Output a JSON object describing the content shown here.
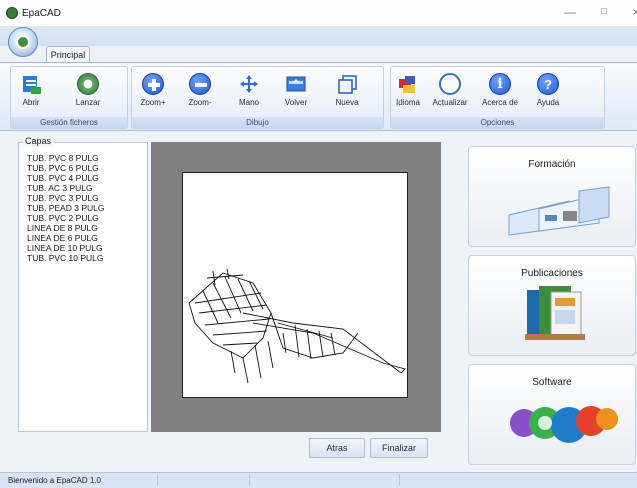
{
  "window": {
    "title": "EpaCAD",
    "minimize": "—",
    "maximize": "□",
    "close": "×"
  },
  "ribbon": {
    "tab": "Principal",
    "groups": [
      {
        "label": "Gestión ficheros",
        "buttons": [
          "Abrir",
          "Lanzar"
        ]
      },
      {
        "label": "Dibujo",
        "buttons": [
          "Zoom+",
          "Zoom-",
          "Mano",
          "Volver",
          "Nueva"
        ]
      },
      {
        "label": "Opciones",
        "buttons": [
          "Idioma",
          "Actualizar",
          "Acerca de",
          "Ayuda"
        ]
      }
    ]
  },
  "layers": {
    "legend": "Capas",
    "items": [
      "TUB. PVC 8 PULG",
      "TUB. PVC 6 PULG",
      "TUB. PVC 4 PULG",
      "TUB. AC 3 PULG",
      "TUB. PVC 3 PULG",
      "TUB. PEAD 3 PULG",
      "TUB. PVC 2 PULG",
      "LINEA DE 8 PULG",
      "LINEA DE 6 PULG",
      "LINEA DE 10 PULG",
      "TUB. PVC 10 PULG"
    ]
  },
  "actions": {
    "back": "Atras",
    "finish": "Finalizar"
  },
  "cards": [
    {
      "title": "Formación"
    },
    {
      "title": "Publicaciones"
    },
    {
      "title": "Software"
    }
  ],
  "status": {
    "text": "Bienvenido a EpaCAD 1.0"
  },
  "icons": {
    "app": "epacad-logo-icon",
    "open": "open-file-icon",
    "launch": "launch-icon",
    "zoom_in": "zoom-in-icon",
    "zoom_out": "zoom-out-icon",
    "pan": "pan-arrows-icon",
    "back": "back-view-icon",
    "new": "new-window-icon",
    "language": "language-icon",
    "update": "update-icon",
    "about": "about-info-icon",
    "help": "help-icon"
  }
}
